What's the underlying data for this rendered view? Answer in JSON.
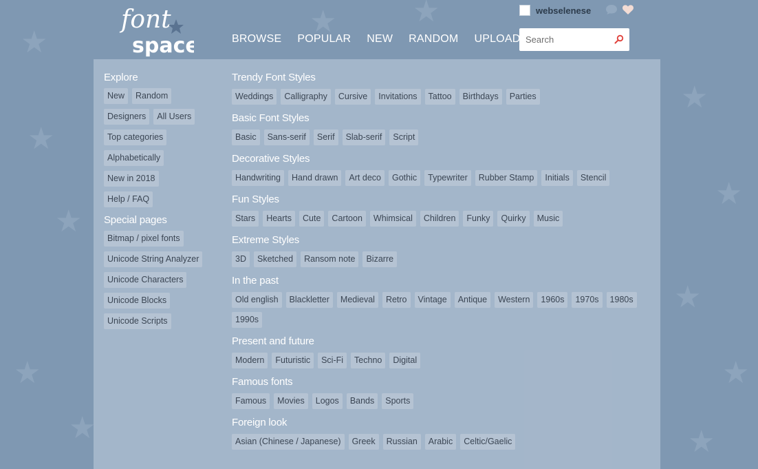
{
  "header": {
    "username": "webselenese",
    "nav": [
      "BROWSE",
      "POPULAR",
      "NEW",
      "RANDOM",
      "UPLOAD"
    ],
    "search_placeholder": "Search",
    "logo_text_top": "font",
    "logo_text_bottom": "space"
  },
  "sidebar": {
    "explore_title": "Explore",
    "explore_rows": [
      [
        "New",
        "Random"
      ],
      [
        "Designers",
        "All Users"
      ],
      [
        "Top categories"
      ],
      [
        "Alphabetically"
      ],
      [
        "New in 2018"
      ],
      [
        "Help / FAQ"
      ]
    ],
    "special_title": "Special pages",
    "special_items": [
      "Bitmap / pixel fonts",
      "Unicode String Analyzer",
      "Unicode Characters",
      "Unicode Blocks",
      "Unicode Scripts"
    ]
  },
  "main": {
    "groups": [
      {
        "title": "Trendy Font Styles",
        "tags": [
          "Weddings",
          "Calligraphy",
          "Cursive",
          "Invitations",
          "Tattoo",
          "Birthdays",
          "Parties"
        ]
      },
      {
        "title": "Basic Font Styles",
        "tags": [
          "Basic",
          "Sans-serif",
          "Serif",
          "Slab-serif",
          "Script"
        ]
      },
      {
        "title": "Decorative Styles",
        "tags": [
          "Handwriting",
          "Hand drawn",
          "Art deco",
          "Gothic",
          "Typewriter",
          "Rubber Stamp",
          "Initials",
          "Stencil"
        ]
      },
      {
        "title": "Fun Styles",
        "tags": [
          "Stars",
          "Hearts",
          "Cute",
          "Cartoon",
          "Whimsical",
          "Children",
          "Funky",
          "Quirky",
          "Music"
        ]
      },
      {
        "title": "Extreme Styles",
        "tags": [
          "3D",
          "Sketched",
          "Ransom note",
          "Bizarre"
        ]
      },
      {
        "title": "In the past",
        "tags": [
          "Old english",
          "Blackletter",
          "Medieval",
          "Retro",
          "Vintage",
          "Antique",
          "Western",
          "1960s",
          "1970s",
          "1980s",
          "1990s"
        ]
      },
      {
        "title": "Present and future",
        "tags": [
          "Modern",
          "Futuristic",
          "Sci-Fi",
          "Techno",
          "Digital"
        ]
      },
      {
        "title": "Famous fonts",
        "tags": [
          "Famous",
          "Movies",
          "Logos",
          "Bands",
          "Sports"
        ]
      },
      {
        "title": "Foreign look",
        "tags": [
          "Asian (Chinese / Japanese)",
          "Greek",
          "Russian",
          "Arabic",
          "Celtic/Gaelic"
        ]
      }
    ]
  },
  "colors": {
    "background": "#7f98b2",
    "panel": "#a7b8ca",
    "tag": "#b5c3d3",
    "search_accent": "#e0403a",
    "heart": "#f3dcd4"
  },
  "icons": [
    "search-icon",
    "chat-icon",
    "heart-icon",
    "star-icon"
  ]
}
